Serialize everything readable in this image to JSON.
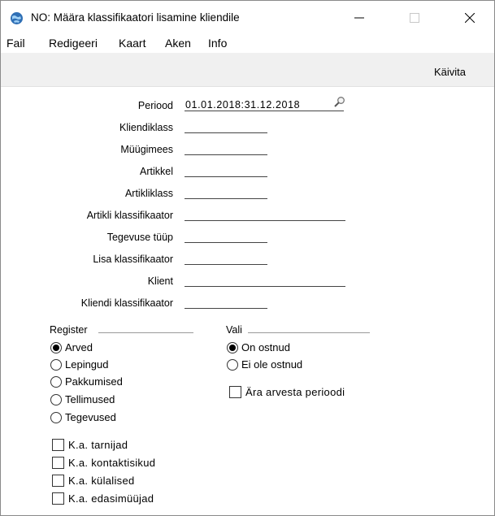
{
  "window": {
    "title": "NO: Määra klassifikaatori lisamine kliendile"
  },
  "menu": [
    "Fail",
    "Redigeeri",
    "Kaart",
    "Aken",
    "Info"
  ],
  "toolbar": {
    "run_label": "Käivita"
  },
  "fields": [
    {
      "label": "Periood",
      "value": "01.01.2018:31.12.2018"
    },
    {
      "label": "Kliendiklass",
      "value": ""
    },
    {
      "label": "Müügimees",
      "value": ""
    },
    {
      "label": "Artikkel",
      "value": ""
    },
    {
      "label": "Artikliklass",
      "value": ""
    },
    {
      "label": "Artikli klassifikaator",
      "value": ""
    },
    {
      "label": "Tegevuse tüüp",
      "value": ""
    },
    {
      "label": "Lisa klassifikaator",
      "value": ""
    },
    {
      "label": "Klient",
      "value": ""
    },
    {
      "label": "Kliendi klassifikaator",
      "value": ""
    }
  ],
  "register": {
    "title": "Register",
    "options": [
      "Arved",
      "Lepingud",
      "Pakkumised",
      "Tellimused",
      "Tegevused"
    ],
    "selected": "Arved"
  },
  "vali": {
    "title": "Vali",
    "options": [
      "On ostnud",
      "Ei ole ostnud"
    ],
    "selected": "On ostnud"
  },
  "checkboxes": {
    "ara_arvesta": {
      "label": "Ära arvesta perioodi",
      "checked": false
    },
    "tarnijad": {
      "label": "K.a. tarnijad",
      "checked": false
    },
    "kontaktisikud": {
      "label": "K.a. kontaktisikud",
      "checked": false
    },
    "kulalised": {
      "label": "K.a. külalised",
      "checked": false
    },
    "edasimuujad": {
      "label": "K.a. edasimüüjad",
      "checked": false
    }
  },
  "colors": {
    "toolbar_bg": "#f0f0f0",
    "icon_blue": "#2f6fb5"
  }
}
